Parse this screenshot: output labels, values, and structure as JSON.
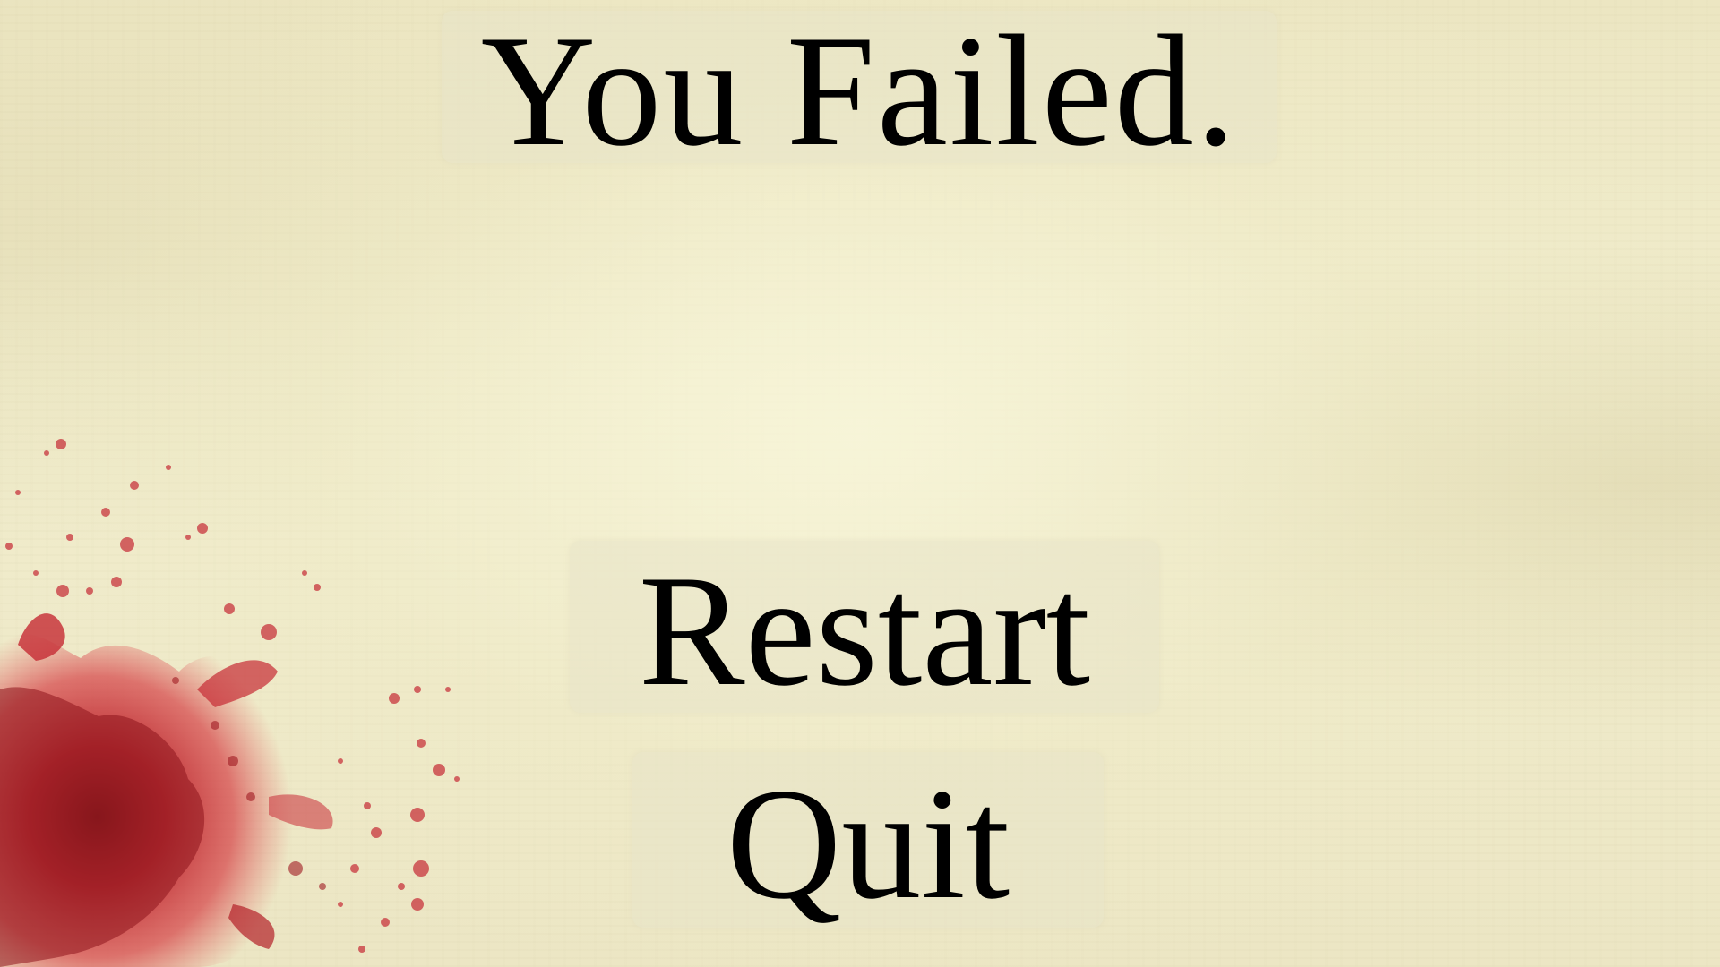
{
  "screen": {
    "title": "You Failed.",
    "background": "aged-paper-texture",
    "decoration": "blood-splatter"
  },
  "menu": {
    "restart_label": "Restart",
    "quit_label": "Quit"
  },
  "colors": {
    "paper": "#f0ecc8",
    "text": "#000000",
    "blood": "#c8202c",
    "blood_dark": "#8a1016"
  }
}
